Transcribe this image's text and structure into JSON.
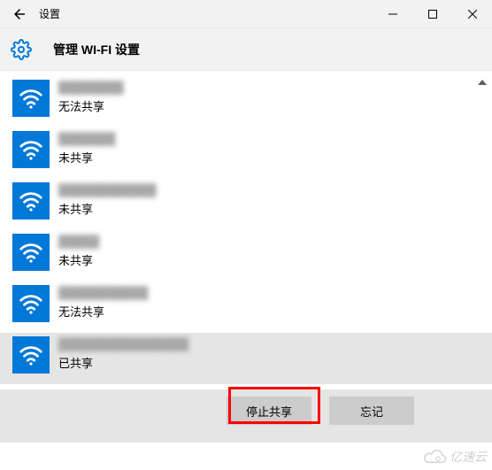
{
  "titlebar": {
    "app_title": "设置"
  },
  "header": {
    "title": "管理 WI-FI 设置"
  },
  "networks": [
    {
      "name_blur": "████████",
      "status": "无法共享",
      "selected": false
    },
    {
      "name_blur": "███████",
      "status": "未共享",
      "selected": false
    },
    {
      "name_blur": "████████████",
      "status": "未共享",
      "selected": false
    },
    {
      "name_blur": "█████",
      "status": "未共享",
      "selected": false
    },
    {
      "name_blur": "███████████",
      "status": "无法共享",
      "selected": false
    },
    {
      "name_blur": "████████████████",
      "status": "已共享",
      "selected": true
    }
  ],
  "actions": {
    "stop_share": "停止共享",
    "forget": "忘记"
  },
  "watermark": {
    "text": "亿速云"
  },
  "colors": {
    "accent": "#0078d7",
    "highlight": "#ff0000"
  }
}
